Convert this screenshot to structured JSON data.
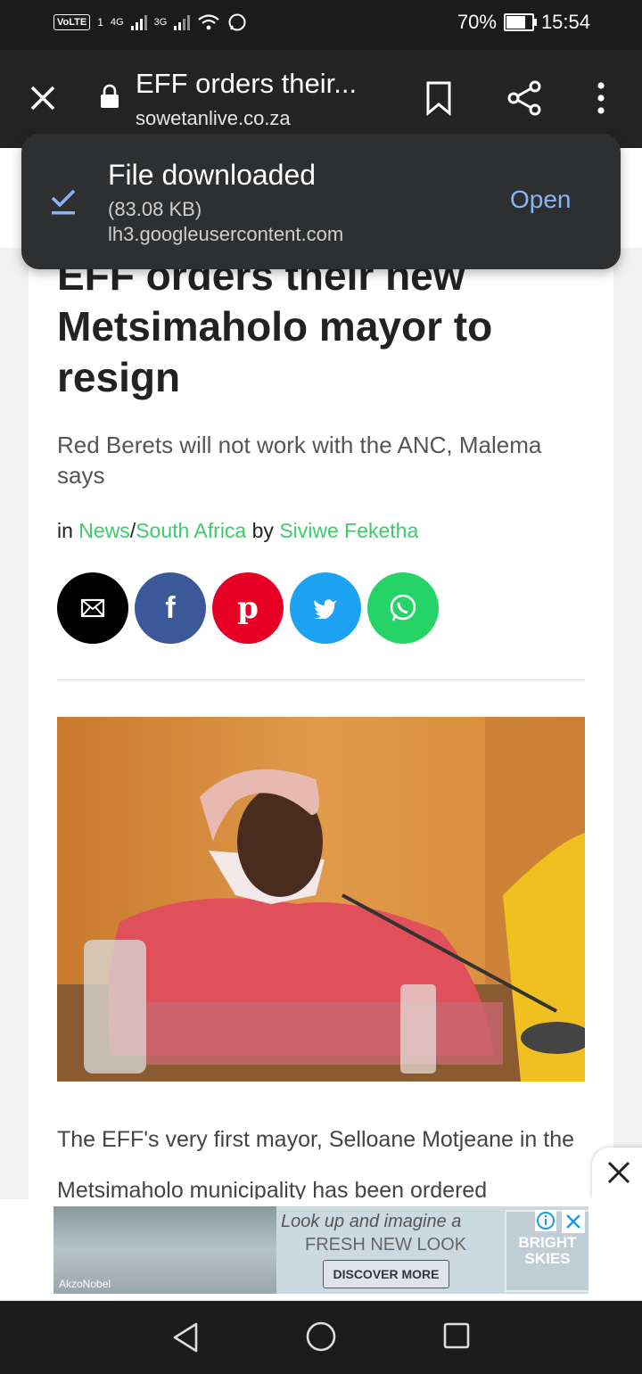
{
  "status_bar": {
    "volte_label": "VoLTE",
    "sim1": "1",
    "net1": "4G",
    "net2": "3G",
    "battery_percent_text": "70%",
    "battery_level": 0.7,
    "time": "15:54"
  },
  "toolbar": {
    "page_title": "EFF orders their...",
    "url": "sowetanlive.co.za"
  },
  "article": {
    "headline": "EFF orders their new Metsimaholo mayor to resign",
    "subtitle": "Red Berets will not work with the ANC, Malema says",
    "byline_in": "in",
    "category1": "News",
    "sep": "/",
    "category2": "South Africa",
    "byline_by": "by",
    "author": "Siviwe Feketha",
    "body": "The EFF's very first mayor, Selloane Motjeane in the Metsimaholo municipality has been ordered",
    "share_buttons": [
      {
        "name": "email",
        "color": "#000000"
      },
      {
        "name": "facebook",
        "color": "#3b5998"
      },
      {
        "name": "pinterest",
        "color": "#e60023"
      },
      {
        "name": "twitter",
        "color": "#1da1f2"
      },
      {
        "name": "whatsapp",
        "color": "#25d366"
      }
    ]
  },
  "download_toast": {
    "title": "File downloaded",
    "size": "(83.08 KB)",
    "host": "lh3.googleusercontent.com",
    "action": "Open"
  },
  "ad": {
    "line1": "Look up and imagine a",
    "line2": "FRESH NEW LOOK",
    "button": "DISCOVER MORE",
    "brand_line1": "BRIGHT",
    "brand_line2": "SKIES",
    "logo": "AkzoNobel"
  },
  "colors": {
    "link_green": "#3ecb6a",
    "toast_action_blue": "#8ab4f8"
  }
}
